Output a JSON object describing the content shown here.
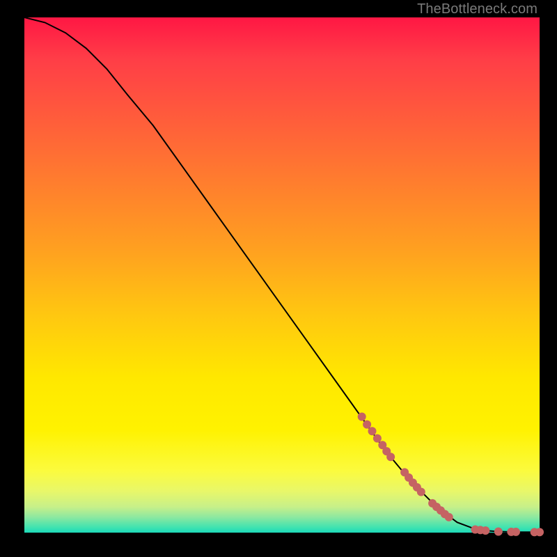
{
  "watermark": "TheBottleneck.com",
  "colors": {
    "curve_stroke": "#000000",
    "dot_fill": "#c56363"
  },
  "chart_data": {
    "type": "line",
    "title": "",
    "xlabel": "",
    "ylabel": "",
    "xlim": [
      0,
      100
    ],
    "ylim": [
      0,
      100
    ],
    "grid": false,
    "legend": false,
    "curve_points": [
      {
        "x": 0,
        "y": 100
      },
      {
        "x": 4,
        "y": 99
      },
      {
        "x": 8,
        "y": 97
      },
      {
        "x": 12,
        "y": 94
      },
      {
        "x": 16,
        "y": 90
      },
      {
        "x": 20,
        "y": 85
      },
      {
        "x": 25,
        "y": 79
      },
      {
        "x": 30,
        "y": 72
      },
      {
        "x": 35,
        "y": 65
      },
      {
        "x": 40,
        "y": 58
      },
      {
        "x": 45,
        "y": 51
      },
      {
        "x": 50,
        "y": 44
      },
      {
        "x": 55,
        "y": 37
      },
      {
        "x": 60,
        "y": 30
      },
      {
        "x": 65,
        "y": 23
      },
      {
        "x": 70,
        "y": 16
      },
      {
        "x": 75,
        "y": 10
      },
      {
        "x": 80,
        "y": 5
      },
      {
        "x": 84,
        "y": 2
      },
      {
        "x": 88,
        "y": 0.5
      },
      {
        "x": 92,
        "y": 0.2
      },
      {
        "x": 96,
        "y": 0.1
      },
      {
        "x": 100,
        "y": 0.1
      }
    ],
    "dot_points": [
      {
        "x": 65.5,
        "y": 22.5
      },
      {
        "x": 66.5,
        "y": 21.0
      },
      {
        "x": 67.5,
        "y": 19.7
      },
      {
        "x": 68.5,
        "y": 18.3
      },
      {
        "x": 69.5,
        "y": 17.0
      },
      {
        "x": 70.3,
        "y": 15.8
      },
      {
        "x": 71.1,
        "y": 14.7
      },
      {
        "x": 73.8,
        "y": 11.7
      },
      {
        "x": 74.6,
        "y": 10.7
      },
      {
        "x": 75.4,
        "y": 9.7
      },
      {
        "x": 76.2,
        "y": 8.8
      },
      {
        "x": 77.0,
        "y": 7.9
      },
      {
        "x": 79.2,
        "y": 5.7
      },
      {
        "x": 80.0,
        "y": 5.0
      },
      {
        "x": 80.8,
        "y": 4.3
      },
      {
        "x": 81.6,
        "y": 3.6
      },
      {
        "x": 82.4,
        "y": 3.0
      },
      {
        "x": 87.5,
        "y": 0.6
      },
      {
        "x": 88.5,
        "y": 0.5
      },
      {
        "x": 89.5,
        "y": 0.4
      },
      {
        "x": 92.0,
        "y": 0.2
      },
      {
        "x": 94.5,
        "y": 0.15
      },
      {
        "x": 95.4,
        "y": 0.15
      },
      {
        "x": 99.0,
        "y": 0.1
      },
      {
        "x": 100.0,
        "y": 0.1
      }
    ],
    "dot_radius": 6
  }
}
